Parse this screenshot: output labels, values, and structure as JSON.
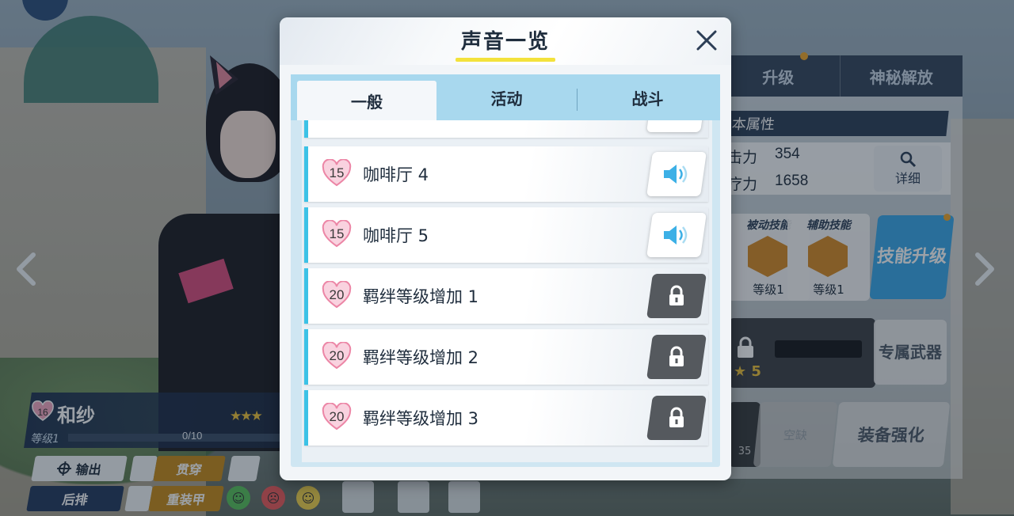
{
  "dialog": {
    "title": "声音一览",
    "tabs": [
      {
        "label": "一般",
        "active": true
      },
      {
        "label": "活动",
        "active": false
      },
      {
        "label": "战斗",
        "active": false
      }
    ],
    "rows": [
      {
        "heart": "15",
        "label": "咖啡厅 4",
        "state": "play"
      },
      {
        "heart": "15",
        "label": "咖啡厅 5",
        "state": "play"
      },
      {
        "heart": "20",
        "label": "羁绊等级增加 1",
        "state": "locked"
      },
      {
        "heart": "20",
        "label": "羁绊等级增加 2",
        "state": "locked"
      },
      {
        "heart": "20",
        "label": "羁绊等级增加 3",
        "state": "locked"
      }
    ]
  },
  "background": {
    "right_tabs": [
      "升级",
      "神秘解放"
    ],
    "attributes_header": "本属性",
    "attributes": [
      {
        "label": "击力",
        "value": "354"
      },
      {
        "label": "疗力",
        "value": "1658"
      }
    ],
    "detail_label": "详细",
    "skills": [
      {
        "title": "被动技能",
        "level": "等级1"
      },
      {
        "title": "辅助技能",
        "level": "等级1"
      }
    ],
    "skill_upgrade": "技能升级",
    "weapon_stars": "5",
    "exclusive_weapon": "专属武器",
    "equip_slot_value": "35",
    "equip_empty": "空缺",
    "equip_enhance": "装备强化",
    "character": {
      "heart": "16",
      "name": "和纱",
      "level_label": "等级1",
      "exp": "0/10",
      "tags": {
        "output": "输出",
        "position": "后排",
        "attack": "贯穿",
        "armor": "重装甲"
      }
    }
  },
  "colors": {
    "accent": "#3cc2e6",
    "locked": "#55595e",
    "heart": "#f4a7c1",
    "underline": "#f3e23c",
    "tab_bar": "#a8d8ee"
  }
}
